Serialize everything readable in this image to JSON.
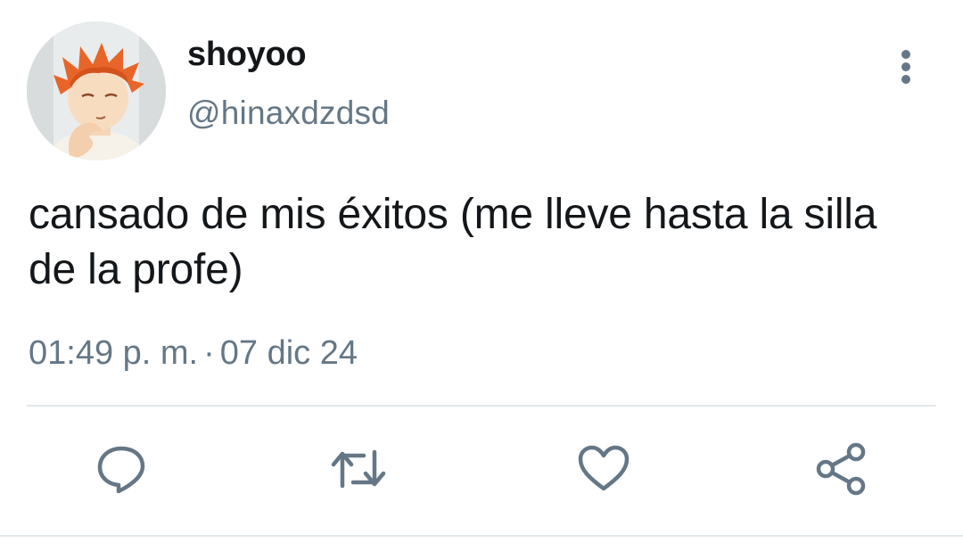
{
  "user": {
    "display_name": "shoyoo",
    "handle": "@hinaxdzdsd"
  },
  "tweet": {
    "text": "cansado de mis éxitos (me lleve hasta la silla de la profe)",
    "time": "01:49 p. m.",
    "separator": "·",
    "date": "07 dic 24"
  },
  "actions": [
    {
      "icon": "reply-icon"
    },
    {
      "icon": "retweet-icon"
    },
    {
      "icon": "like-heart-icon"
    },
    {
      "icon": "share-icon"
    }
  ],
  "colors": {
    "text_primary": "#14171a",
    "text_secondary": "#657786",
    "divider": "#e1e8ed",
    "icon": "#657786",
    "avatar_hair": "#e8652a"
  }
}
